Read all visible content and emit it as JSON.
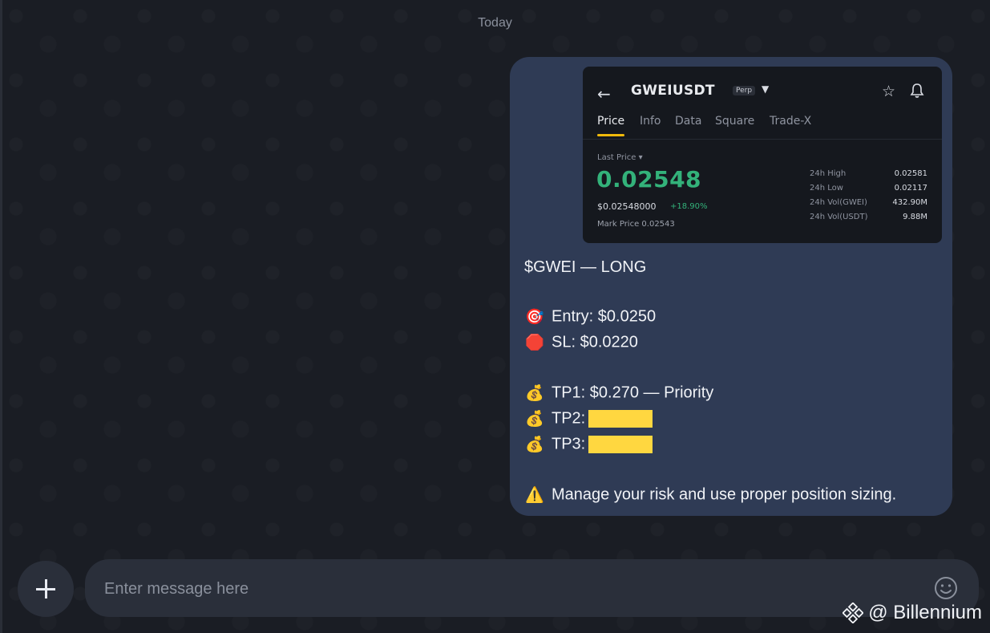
{
  "chat": {
    "date_label": "Today"
  },
  "screenshot": {
    "symbol": "GWEIUSDT",
    "badge": "Perp",
    "tabs": [
      "Price",
      "Info",
      "Data",
      "Square",
      "Trade-X"
    ],
    "last_price_label": "Last Price",
    "price": "0.02548",
    "price_usd": "$0.02548000",
    "change": "+18.90%",
    "mark_price": "Mark Price 0.02543",
    "stats": [
      {
        "label": "24h High",
        "value": "0.02581"
      },
      {
        "label": "24h Low",
        "value": "0.02117"
      },
      {
        "label": "24h Vol(GWEI)",
        "value": "432.90M"
      },
      {
        "label": "24h Vol(USDT)",
        "value": "9.88M"
      }
    ],
    "accent_color": "#33b27a",
    "tab_underline_color": "#f0b90b"
  },
  "message": {
    "title": "$GWEI — LONG",
    "entry_emoji": "🎯",
    "entry": "Entry: $0.0250",
    "sl_emoji": "🛑",
    "sl": "SL: $0.0220",
    "tp_emoji": "💰",
    "tp1": "TP1: $0.270 — Priority",
    "tp2": "TP2:",
    "tp3": "TP3:",
    "warning_emoji": "⚠️",
    "warning": "Manage your risk and use proper position sizing."
  },
  "composer": {
    "placeholder": "Enter message here",
    "value": ""
  },
  "watermark": {
    "text": "@ Billennium"
  },
  "colors": {
    "background": "#1a1d24",
    "bubble": "#2f3b55",
    "redaction": "#ffd740"
  }
}
